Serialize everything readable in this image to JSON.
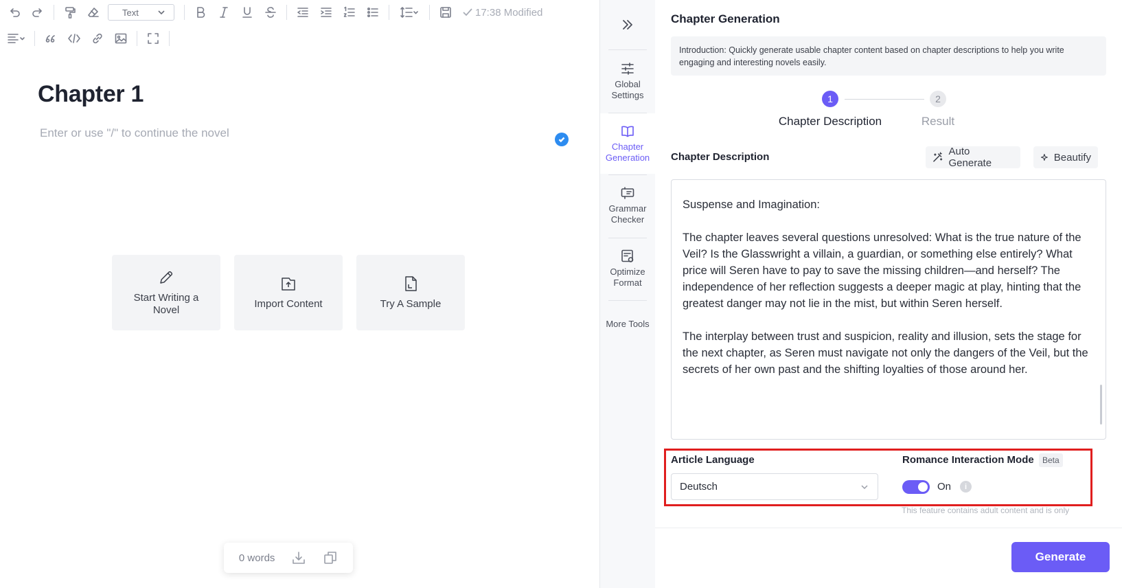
{
  "toolbar": {
    "text_style": "Text",
    "modified": "17:38 Modified"
  },
  "editor": {
    "chapter_title": "Chapter 1",
    "placeholder": "Enter or use \"/\" to continue the novel",
    "start_cards": [
      {
        "label": "Start Writing a Novel",
        "icon": "pencil-icon"
      },
      {
        "label": "Import Content",
        "icon": "import-icon"
      },
      {
        "label": "Try A Sample",
        "icon": "sample-icon"
      }
    ],
    "word_count": "0 words"
  },
  "rail": {
    "items": [
      {
        "label": "Global Settings",
        "icon": "sliders-icon"
      },
      {
        "label": "Chapter Generation",
        "icon": "book-icon"
      },
      {
        "label": "Grammar Checker",
        "icon": "grammar-icon"
      },
      {
        "label": "Optimize Format",
        "icon": "format-icon"
      },
      {
        "label": "More Tools",
        "icon": ""
      }
    ]
  },
  "panel": {
    "title": "Chapter Generation",
    "intro": "Introduction: Quickly generate usable chapter content based on chapter descriptions to help you write engaging and interesting novels easily.",
    "steps": [
      {
        "number": "1",
        "label": "Chapter Description"
      },
      {
        "number": "2",
        "label": "Result"
      }
    ],
    "description_heading": "Chapter Description",
    "auto_generate_label": "Auto Generate",
    "beautify_label": "Beautify",
    "description_paragraphs": [
      "Suspense and Imagination:",
      "The chapter leaves several questions unresolved: What is the true nature of the Veil? Is the Glasswright a villain, a guardian, or something else entirely? What price will Seren have to pay to save the missing children—and herself? The independence of her reflection suggests a deeper magic at play, hinting that the greatest danger may not lie in the mist, but within Seren herself.",
      "The interplay between trust and suspicion, reality and illusion, sets the stage for the next chapter, as Seren must navigate not only the dangers of the Veil, but the secrets of her own past and the shifting loyalties of those around her."
    ],
    "article_language_label": "Article Language",
    "article_language_value": "Deutsch",
    "romance_mode_label": "Romance Interaction Mode",
    "beta_badge": "Beta",
    "toggle_label": "On",
    "toggle_on": true,
    "info_glyph": "i",
    "adult_note": "This feature contains adult content and is only",
    "generate_label": "Generate"
  },
  "colors": {
    "accent": "#6b5cf6",
    "highlight_border": "#e01e1e",
    "check_badge": "#2d8cf0"
  }
}
